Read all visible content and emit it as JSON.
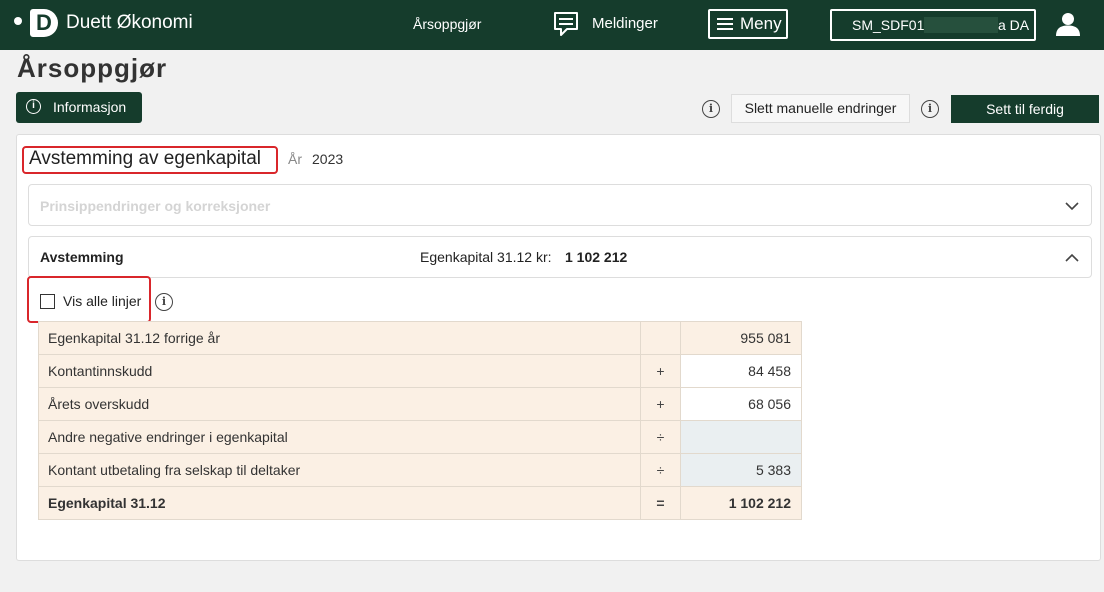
{
  "topbar": {
    "app_name": "Duett Økonomi",
    "logo_letter": "D",
    "nav_arsoppgjor": "Årsoppgjør",
    "nav_meldinger": "Meldinger",
    "menu_label": "Meny",
    "company_code": "SM_SDF01",
    "company_suffix": "a DA"
  },
  "header": {
    "page_title": "Årsoppgjør",
    "info_button": "Informasjon",
    "delete_manual_button": "Slett manuelle endringer",
    "mark_done_button": "Sett til ferdig"
  },
  "section": {
    "title": "Avstemming av egenkapital",
    "year_label": "År",
    "year_value": "2023"
  },
  "panels": {
    "prinsipp_title": "Prinsippendringer og korreksjoner",
    "avstemming_title": "Avstemming",
    "egenkapital_label": "Egenkapital 31.12 kr:",
    "egenkapital_value": "1 102 212"
  },
  "show_all": {
    "label": "Vis alle linjer",
    "checked": false
  },
  "table": {
    "rows": [
      {
        "label": "Egenkapital 31.12 forrige år",
        "op": "",
        "value": "955 081"
      },
      {
        "label": "Kontantinnskudd",
        "op": "+",
        "value": "84 458"
      },
      {
        "label": "Årets overskudd",
        "op": "+",
        "value": "68 056"
      },
      {
        "label": "Andre negative endringer i egenkapital",
        "op": "÷",
        "value": ""
      },
      {
        "label": "Kontant utbetaling fra selskap til deltaker",
        "op": "÷",
        "value": "5 383"
      },
      {
        "label": "Egenkapital 31.12",
        "op": "=",
        "value": "1 102 212"
      }
    ]
  },
  "icons": {
    "logo": "duett-logo-icon",
    "messages": "chat-bubble-icon",
    "menu": "hamburger-icon",
    "user": "user-icon",
    "info": "info-circle-icon",
    "chevron_down": "chevron-down-icon",
    "chevron_up": "chevron-up-icon"
  },
  "colors": {
    "brand_dark_green": "#153c2c",
    "highlight_red": "#d9262b",
    "row_beige": "#fbf0e4",
    "row_blue": "#eaeff1"
  }
}
